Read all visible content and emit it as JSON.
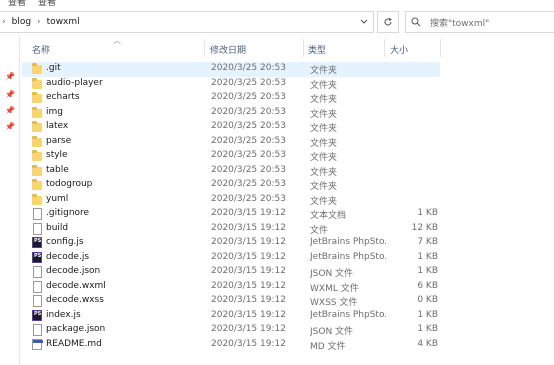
{
  "top_strip": {
    "left_label": "查看",
    "right_label": "查看"
  },
  "addressbar": {
    "breadcrumbs": [
      "blog",
      "towxml"
    ],
    "separator": "›",
    "dropdown_icon": "chevron-down-icon",
    "refresh_icon": "refresh-icon"
  },
  "search": {
    "placeholder": "搜索\"towxml\"",
    "icon": "search-icon"
  },
  "columns": {
    "name": "名称",
    "modified": "修改日期",
    "type": "类型",
    "size": "大小"
  },
  "files": [
    {
      "name": ".git",
      "date": "2020/3/25 20:53",
      "type": "文件夹",
      "size": "",
      "icon": "folder-icon",
      "selected": true
    },
    {
      "name": "audio-player",
      "date": "2020/3/25 20:53",
      "type": "文件夹",
      "size": "",
      "icon": "folder-icon"
    },
    {
      "name": "echarts",
      "date": "2020/3/25 20:53",
      "type": "文件夹",
      "size": "",
      "icon": "folder-icon"
    },
    {
      "name": "img",
      "date": "2020/3/25 20:53",
      "type": "文件夹",
      "size": "",
      "icon": "folder-icon"
    },
    {
      "name": "latex",
      "date": "2020/3/25 20:53",
      "type": "文件夹",
      "size": "",
      "icon": "folder-icon"
    },
    {
      "name": "parse",
      "date": "2020/3/25 20:53",
      "type": "文件夹",
      "size": "",
      "icon": "folder-icon"
    },
    {
      "name": "style",
      "date": "2020/3/25 20:53",
      "type": "文件夹",
      "size": "",
      "icon": "folder-icon"
    },
    {
      "name": "table",
      "date": "2020/3/25 20:53",
      "type": "文件夹",
      "size": "",
      "icon": "folder-icon"
    },
    {
      "name": "todogroup",
      "date": "2020/3/25 20:53",
      "type": "文件夹",
      "size": "",
      "icon": "folder-icon"
    },
    {
      "name": "yuml",
      "date": "2020/3/25 20:53",
      "type": "文件夹",
      "size": "",
      "icon": "folder-icon"
    },
    {
      "name": ".gitignore",
      "date": "2020/3/15 19:12",
      "type": "文本文档",
      "size": "1 KB",
      "icon": "text-file-icon"
    },
    {
      "name": "build",
      "date": "2020/3/15 19:12",
      "type": "文件",
      "size": "12 KB",
      "icon": "file-icon"
    },
    {
      "name": "config.js",
      "date": "2020/3/15 19:12",
      "type": "JetBrains PhpSto...",
      "size": "7 KB",
      "icon": "phpstorm-file-icon"
    },
    {
      "name": "decode.js",
      "date": "2020/3/15 19:12",
      "type": "JetBrains PhpSto...",
      "size": "1 KB",
      "icon": "phpstorm-file-icon"
    },
    {
      "name": "decode.json",
      "date": "2020/3/15 19:12",
      "type": "JSON 文件",
      "size": "1 KB",
      "icon": "file-icon"
    },
    {
      "name": "decode.wxml",
      "date": "2020/3/15 19:12",
      "type": "WXML 文件",
      "size": "6 KB",
      "icon": "file-icon"
    },
    {
      "name": "decode.wxss",
      "date": "2020/3/15 19:12",
      "type": "WXSS 文件",
      "size": "0 KB",
      "icon": "file-icon"
    },
    {
      "name": "index.js",
      "date": "2020/3/15 19:12",
      "type": "JetBrains PhpSto...",
      "size": "1 KB",
      "icon": "phpstorm-file-icon"
    },
    {
      "name": "package.json",
      "date": "2020/3/15 19:12",
      "type": "JSON 文件",
      "size": "1 KB",
      "icon": "file-icon"
    },
    {
      "name": "README.md",
      "date": "2020/3/15 19:12",
      "type": "MD 文件",
      "size": "4 KB",
      "icon": "markdown-file-icon"
    }
  ],
  "colors": {
    "selection": "#e5f3ff",
    "folder": "#f7d671",
    "header_text": "#4c607a"
  }
}
